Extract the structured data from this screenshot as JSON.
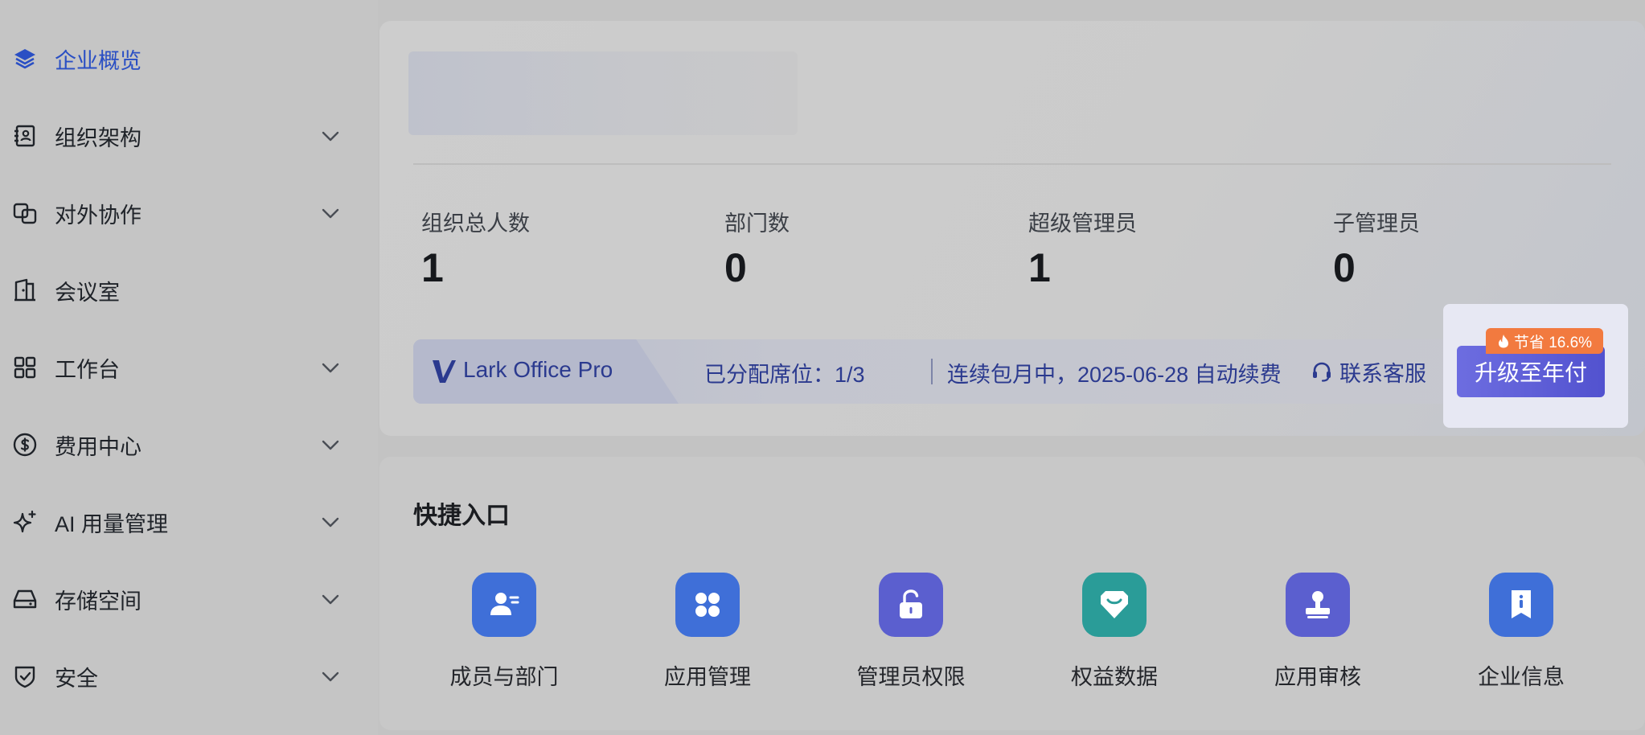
{
  "sidebar": {
    "items": [
      {
        "label": "企业概览",
        "icon": "layers-icon",
        "active": true,
        "expandable": false
      },
      {
        "label": "组织架构",
        "icon": "contacts-book-icon",
        "expandable": true
      },
      {
        "label": "对外协作",
        "icon": "link-squares-icon",
        "expandable": true
      },
      {
        "label": "会议室",
        "icon": "door-icon",
        "expandable": false
      },
      {
        "label": "工作台",
        "icon": "grid-icon",
        "expandable": true
      },
      {
        "label": "费用中心",
        "icon": "dollar-circle-icon",
        "expandable": true
      },
      {
        "label": "AI 用量管理",
        "icon": "sparkle-icon",
        "expandable": true
      },
      {
        "label": "存储空间",
        "icon": "hard-drive-icon",
        "expandable": true
      },
      {
        "label": "安全",
        "icon": "shield-check-icon",
        "expandable": true
      }
    ],
    "active_color": "#2a4fc4"
  },
  "overview": {
    "stats": [
      {
        "label": "组织总人数",
        "value": "1"
      },
      {
        "label": "部门数",
        "value": "0"
      },
      {
        "label": "超级管理员",
        "value": "1"
      },
      {
        "label": "子管理员",
        "value": "0"
      }
    ],
    "plan": {
      "name": "Lark Office Pro",
      "seats": "已分配席位：1/3",
      "renewal": "连续包月中，2025-06-28 自动续费",
      "support_label": "联系客服",
      "upgrade_label": "升级至年付",
      "save_badge": "节省 16.6%",
      "accent_color": "#5252cf",
      "badge_color": "#f27a3f"
    }
  },
  "quick_entry": {
    "title": "快捷入口",
    "items": [
      {
        "label": "成员与部门",
        "icon": "member-icon",
        "color": "#3f6fd8"
      },
      {
        "label": "应用管理",
        "icon": "apps-icon",
        "color": "#3f6fd8"
      },
      {
        "label": "管理员权限",
        "icon": "unlock-icon",
        "color": "#5b5fcf"
      },
      {
        "label": "权益数据",
        "icon": "diamond-icon",
        "color": "#2a9c98"
      },
      {
        "label": "应用审核",
        "icon": "stamp-icon",
        "color": "#5b5fcf"
      },
      {
        "label": "企业信息",
        "icon": "info-bookmark-icon",
        "color": "#3f6fd8"
      }
    ]
  }
}
